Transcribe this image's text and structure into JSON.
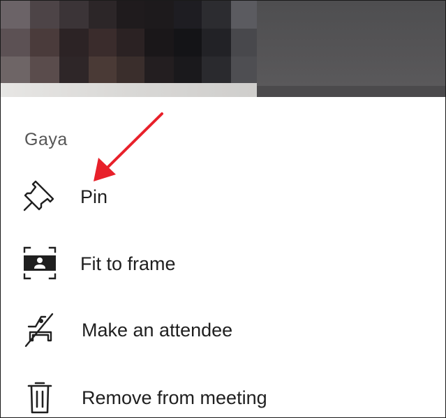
{
  "participant_menu": {
    "name": "Gaya",
    "items": [
      {
        "label": "Pin",
        "icon": "pin-icon"
      },
      {
        "label": "Fit to frame",
        "icon": "fit-to-frame-icon"
      },
      {
        "label": "Make an attendee",
        "icon": "make-attendee-icon"
      },
      {
        "label": "Remove from meeting",
        "icon": "trash-icon"
      }
    ]
  },
  "colors": {
    "annotation_arrow": "#e8202a",
    "text_primary": "#1f1f1f",
    "text_secondary": "#555555",
    "sheet_background": "#ffffff",
    "video_background": "#4b4a4c"
  }
}
